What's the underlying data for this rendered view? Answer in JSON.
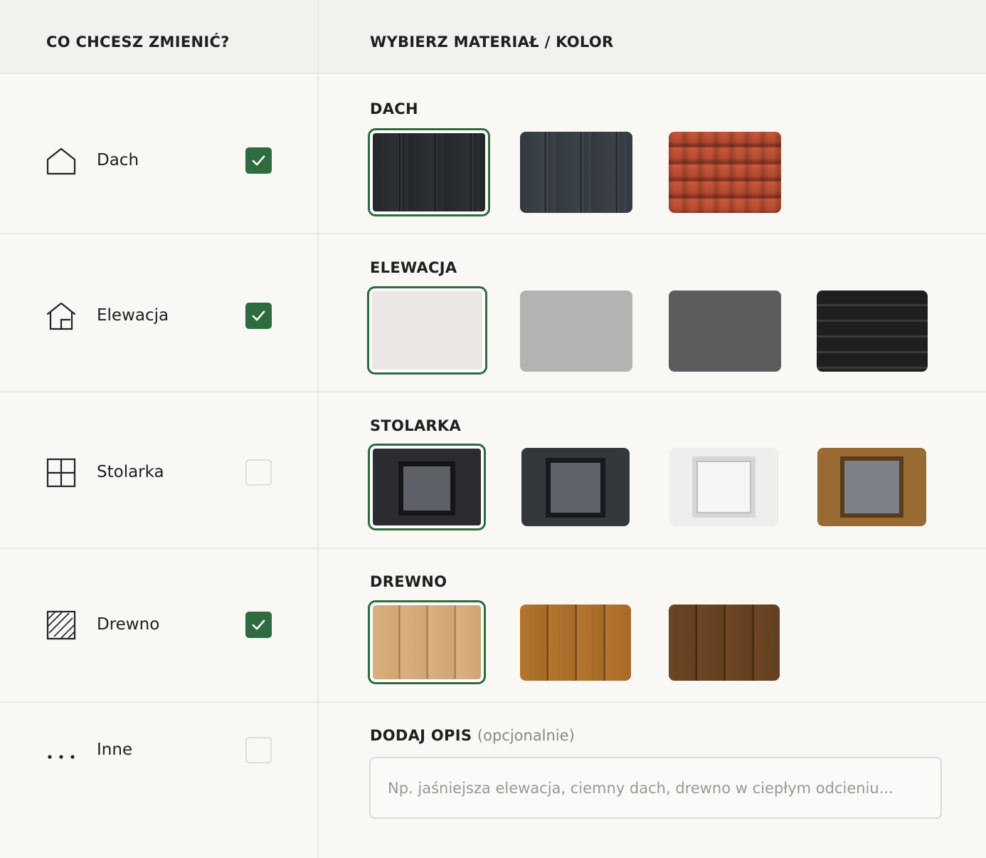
{
  "header": {
    "left_title": "CO CHCESZ ZMIENIĆ?",
    "right_title": "WYBIERZ MATERIAŁ / KOLOR"
  },
  "options": [
    {
      "label": "Dach",
      "icon": "roof-icon",
      "checked": true
    },
    {
      "label": "Elewacja",
      "icon": "house-facade-icon",
      "checked": true
    },
    {
      "label": "Stolarka",
      "icon": "window-icon",
      "checked": false
    },
    {
      "label": "Drewno",
      "icon": "wood-texture-icon",
      "checked": true
    },
    {
      "label": "Inne",
      "icon": "more-dots-icon",
      "checked": false
    }
  ],
  "sections": {
    "dach": {
      "title": "DACH",
      "swatches": [
        "graphite standing-seam metal",
        "dark grey standing-seam metal",
        "red clay tile"
      ],
      "selected": 0
    },
    "elewacja": {
      "title": "ELEWACJA",
      "swatches": [
        "white plaster",
        "light grey plaster",
        "dark grey plaster",
        "black brick"
      ],
      "selected": 0
    },
    "stolarka": {
      "title": "STOLARKA",
      "swatches": [
        "black window",
        "anthracite window",
        "white window",
        "wood window"
      ],
      "selected": 0
    },
    "drewno": {
      "title": "DREWNO",
      "swatches": [
        "light pine",
        "golden oak",
        "dark walnut"
      ],
      "selected": 0
    }
  },
  "description": {
    "title": "DODAJ OPIS",
    "optional_note": "(opcjonalnie)",
    "placeholder": "Np. jaśniejsza elewacja, ciemny dach, drewno w ciepłym odcieniu...",
    "value": ""
  },
  "colors": {
    "accent": "#2e6b3e",
    "background": "#faf8f5",
    "header_bg": "#f3f1ed"
  }
}
